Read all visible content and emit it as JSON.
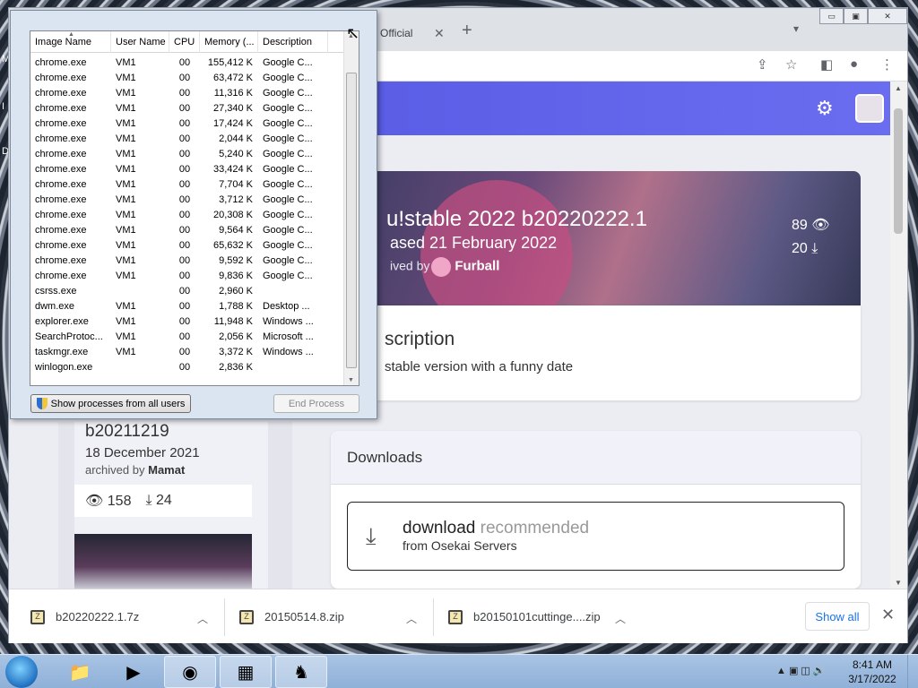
{
  "wallpaper": {
    "left_letters": [
      "M",
      "I",
      "D"
    ]
  },
  "browser": {
    "tab_title": "Official I",
    "tab_close": "✕",
    "new_tab": "+",
    "window_buttons": {
      "minimize": "▭",
      "maximize": "▣",
      "close": "✕"
    },
    "toolbar_icons": [
      "share-icon",
      "star-icon",
      "side-panel-icon",
      "profile-icon",
      "menu-icon"
    ]
  },
  "page": {
    "hero": {
      "title": "u!stable 2022 b20220222.1",
      "released": "ased 21 February 2022",
      "archived_prefix": "ived by",
      "archiver": "Furball",
      "views": "89",
      "downloads": "20"
    },
    "description": {
      "title": "scription",
      "text": "stable version with a funny date"
    },
    "downloads_card": {
      "header": "Downloads",
      "button_main": "download",
      "button_tag": "recommended",
      "button_sub": "from Osekai Servers"
    },
    "side_card": {
      "title": "b20211219",
      "date": "18 December 2021",
      "archived_prefix": "archived by",
      "archiver": "Mamat",
      "views": "158",
      "downloads": "24"
    }
  },
  "download_shelf": {
    "items": [
      {
        "name": "b20220222.1.7z"
      },
      {
        "name": "20150514.8.zip"
      },
      {
        "name": "b20150101cuttinge....zip"
      }
    ],
    "show_all": "Show all",
    "close": "✕"
  },
  "task_manager": {
    "columns": [
      "Image Name",
      "User Name",
      "CPU",
      "Memory (...",
      "Description"
    ],
    "rows": [
      [
        "chrome.exe",
        "VM1",
        "00",
        "155,412 K",
        "Google C..."
      ],
      [
        "chrome.exe",
        "VM1",
        "00",
        "63,472 K",
        "Google C..."
      ],
      [
        "chrome.exe",
        "VM1",
        "00",
        "11,316 K",
        "Google C..."
      ],
      [
        "chrome.exe",
        "VM1",
        "00",
        "27,340 K",
        "Google C..."
      ],
      [
        "chrome.exe",
        "VM1",
        "00",
        "17,424 K",
        "Google C..."
      ],
      [
        "chrome.exe",
        "VM1",
        "00",
        "2,044 K",
        "Google C..."
      ],
      [
        "chrome.exe",
        "VM1",
        "00",
        "5,240 K",
        "Google C..."
      ],
      [
        "chrome.exe",
        "VM1",
        "00",
        "33,424 K",
        "Google C..."
      ],
      [
        "chrome.exe",
        "VM1",
        "00",
        "7,704 K",
        "Google C..."
      ],
      [
        "chrome.exe",
        "VM1",
        "00",
        "3,712 K",
        "Google C..."
      ],
      [
        "chrome.exe",
        "VM1",
        "00",
        "20,308 K",
        "Google C..."
      ],
      [
        "chrome.exe",
        "VM1",
        "00",
        "9,564 K",
        "Google C..."
      ],
      [
        "chrome.exe",
        "VM1",
        "00",
        "65,632 K",
        "Google C..."
      ],
      [
        "chrome.exe",
        "VM1",
        "00",
        "9,592 K",
        "Google C..."
      ],
      [
        "chrome.exe",
        "VM1",
        "00",
        "9,836 K",
        "Google C..."
      ],
      [
        "csrss.exe",
        "",
        "00",
        "2,960 K",
        ""
      ],
      [
        "dwm.exe",
        "VM1",
        "00",
        "1,788 K",
        "Desktop ..."
      ],
      [
        "explorer.exe",
        "VM1",
        "00",
        "11,948 K",
        "Windows ..."
      ],
      [
        "SearchProtoc...",
        "VM1",
        "00",
        "2,056 K",
        "Microsoft ..."
      ],
      [
        "taskmgr.exe",
        "VM1",
        "00",
        "3,372 K",
        "Windows ..."
      ],
      [
        "winlogon.exe",
        "",
        "00",
        "2,836 K",
        ""
      ]
    ],
    "show_all_users": "Show processes from all users",
    "end_process": "End Process"
  },
  "taskbar": {
    "apps": [
      "explorer-icon",
      "media-player-icon",
      "chrome-icon",
      "task-manager-icon",
      "chess-icon"
    ],
    "time": "8:41 AM",
    "date": "3/17/2022"
  }
}
